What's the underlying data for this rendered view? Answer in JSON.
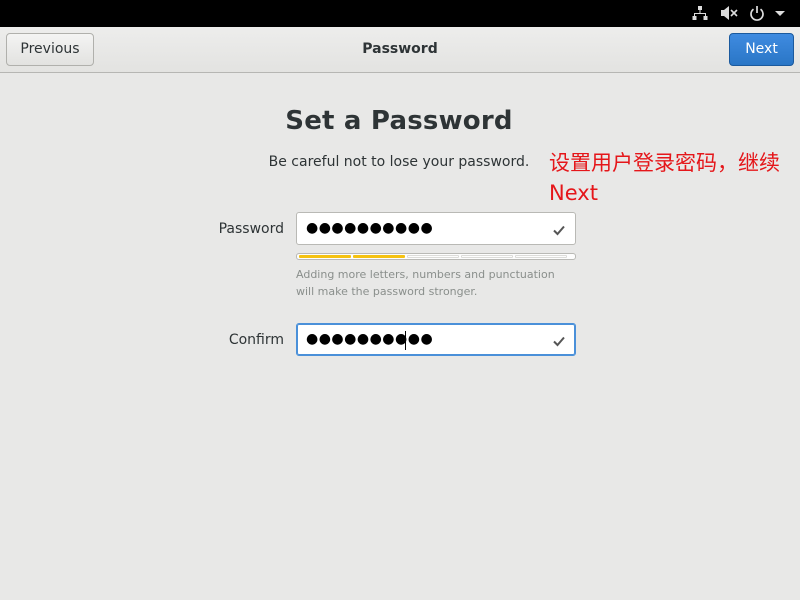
{
  "system_bar": {
    "icons": [
      "network-icon",
      "volume-muted-icon",
      "power-icon",
      "dropdown-arrow-icon"
    ]
  },
  "header": {
    "previous_label": "Previous",
    "title": "Password",
    "next_label": "Next"
  },
  "main": {
    "title": "Set a Password",
    "subtitle": "Be careful not to lose your password.",
    "annotation_line1": "设置用户登录密码，继续",
    "annotation_line2": "Next",
    "password": {
      "label": "Password",
      "masked_value": "●●●●●●●●●●",
      "valid_icon": "checkmark-icon",
      "strength_level": 0.4,
      "strength_segments": 5,
      "strength_color": "#f5c211",
      "hint": "Adding more letters, numbers and punctuation will make the password stronger."
    },
    "confirm": {
      "label": "Confirm",
      "masked_value": "●●●●●●●●●●",
      "valid_icon": "checkmark-icon"
    }
  },
  "colors": {
    "accent": "#2a76c6",
    "annotation": "#e5161a",
    "focus": "#4a90d9"
  }
}
